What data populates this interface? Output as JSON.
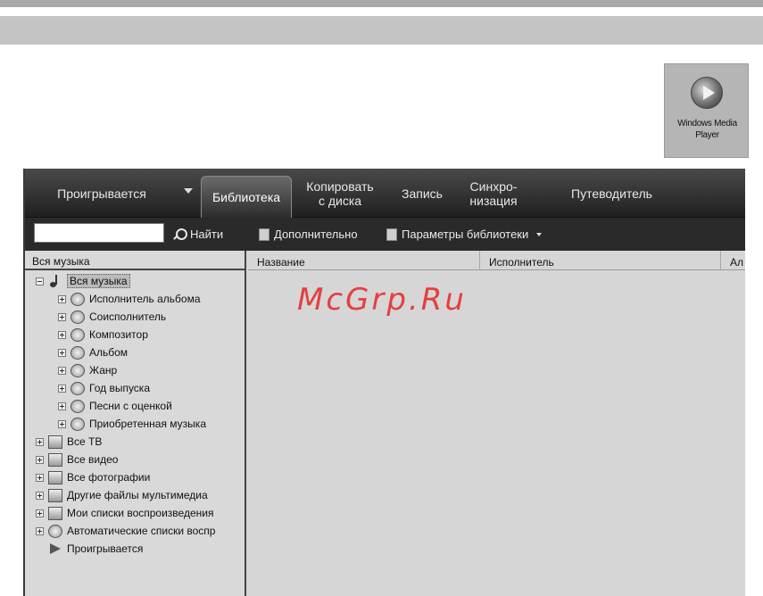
{
  "desktop_icon": {
    "label_line1": "Windows Media",
    "label_line2": "Player",
    "icon": "windows-media-player-icon"
  },
  "nav": {
    "now_playing": "Проигрывается",
    "library": "Библиотека",
    "rip_line1": "Копировать",
    "rip_line2": "с диска",
    "burn": "Запись",
    "sync_line1": "Синхро-",
    "sync_line2": "низация",
    "guide": "Путеводитель"
  },
  "toolbar": {
    "search_value": "",
    "find": "Найти",
    "more": "Дополнительно",
    "library_options": "Параметры библиотеки"
  },
  "left_pane": {
    "header": "Вся музыка",
    "tree": [
      {
        "label": "Вся музыка",
        "level": 0,
        "expander": "minus",
        "icon": "music-note-icon",
        "selected": true
      },
      {
        "label": "Исполнитель альбома",
        "level": 1,
        "expander": "plus",
        "icon": "album-artist-icon"
      },
      {
        "label": "Соисполнитель",
        "level": 1,
        "expander": "plus",
        "icon": "contributing-artist-icon"
      },
      {
        "label": "Композитор",
        "level": 1,
        "expander": "plus",
        "icon": "composer-icon"
      },
      {
        "label": "Альбом",
        "level": 1,
        "expander": "plus",
        "icon": "album-icon"
      },
      {
        "label": "Жанр",
        "level": 1,
        "expander": "plus",
        "icon": "genre-icon"
      },
      {
        "label": "Год выпуска",
        "level": 1,
        "expander": "plus",
        "icon": "release-year-icon"
      },
      {
        "label": "Песни с оценкой",
        "level": 1,
        "expander": "plus",
        "icon": "rated-songs-icon"
      },
      {
        "label": "Приобретенная музыка",
        "level": 1,
        "expander": "plus",
        "icon": "purchased-music-icon"
      },
      {
        "label": "Все ТВ",
        "level": 0,
        "expander": "plus",
        "icon": "tv-icon"
      },
      {
        "label": "Все видео",
        "level": 0,
        "expander": "plus",
        "icon": "video-icon"
      },
      {
        "label": "Все фотографии",
        "level": 0,
        "expander": "plus",
        "icon": "photos-icon"
      },
      {
        "label": "Другие файлы мультимедиа",
        "level": 0,
        "expander": "plus",
        "icon": "other-media-icon"
      },
      {
        "label": "Мои списки воспроизведения",
        "level": 0,
        "expander": "plus",
        "icon": "playlist-icon"
      },
      {
        "label": "Автоматические списки воспр",
        "level": 0,
        "expander": "plus",
        "icon": "auto-playlist-icon"
      },
      {
        "label": "Проигрывается",
        "level": 0,
        "expander": "none",
        "icon": "play-icon"
      }
    ]
  },
  "columns": [
    "Название",
    "Исполнитель",
    "Ал"
  ],
  "watermark": "McGrp.Ru"
}
